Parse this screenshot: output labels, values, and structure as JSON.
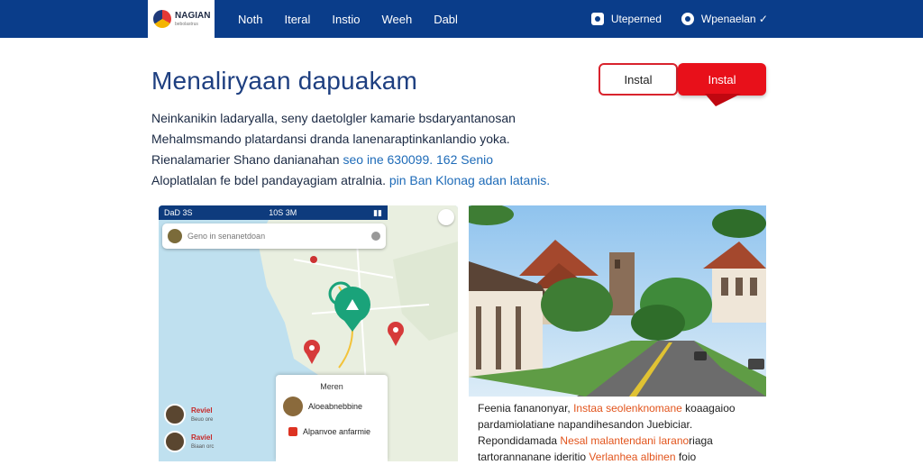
{
  "header": {
    "logo": {
      "name": "NAGIAN",
      "sub": "bebolastrus"
    },
    "nav": [
      "Noth",
      "Iteral",
      "Instio",
      "Weeh",
      "Dabl"
    ],
    "right": [
      {
        "icon": "app-icon",
        "label": "Uteperned"
      },
      {
        "icon": "location-icon",
        "label": "Wpenaelan ✓"
      }
    ]
  },
  "hero": {
    "title": "Menaliryaan dapuakam",
    "btn_outline": "Instal",
    "btn_primary": "Instal"
  },
  "intro": {
    "lines": [
      {
        "text": "Neinkanikin ladaryalla, seny daetolgler kamarie bsdaryantanosan",
        "hl": ""
      },
      {
        "text": "Mehalmsmando platardansi dranda lanenaraptinkanlandio yoka.",
        "hl": ""
      },
      {
        "text": "Rienalamarier Shano danianahan ",
        "hl": "seo ine 630099. 162 Senio"
      },
      {
        "text": "Aloplatlalan fe bdel pandayagiam atralnia. ",
        "hl": "pin Ban Klonag adan latanis."
      }
    ]
  },
  "map": {
    "status_time": "10S 3M",
    "status_left": "DaD 3S",
    "search_placeholder": "Geno in senanetdoan",
    "panel_title": "Meren",
    "panel_rows": [
      "Aloeabnebbine",
      "Alpanvoe anfarmie"
    ],
    "side_people": [
      {
        "name": "Reviel",
        "sub": "Beuo ore"
      },
      {
        "name": "Raviel",
        "sub": "Biaan orc"
      }
    ]
  },
  "photo_caption": {
    "lines": [
      {
        "pre": "Feenia fananonyar, ",
        "or": "Instaa seolenknomane",
        "post": " koaagaioo"
      },
      {
        "pre": "pardamiolatiane napandihesandon Juebiciar.",
        "or": "",
        "post": ""
      },
      {
        "pre": "Repondidamada ",
        "or": "Nesal malantendani larano",
        "post": "riaga"
      },
      {
        "pre": "tartorannanane ideritio ",
        "or": "Verlanhea albinen",
        "post": " foio"
      }
    ]
  },
  "colors": {
    "topbar": "#0a3d8a",
    "title": "#1e3f80",
    "accent_red": "#e8101a",
    "link_blue": "#1e6bb8",
    "caption_orange": "#e2541c",
    "map_pin_green": "#1aa37a",
    "map_pin_red": "#d63a3a"
  }
}
